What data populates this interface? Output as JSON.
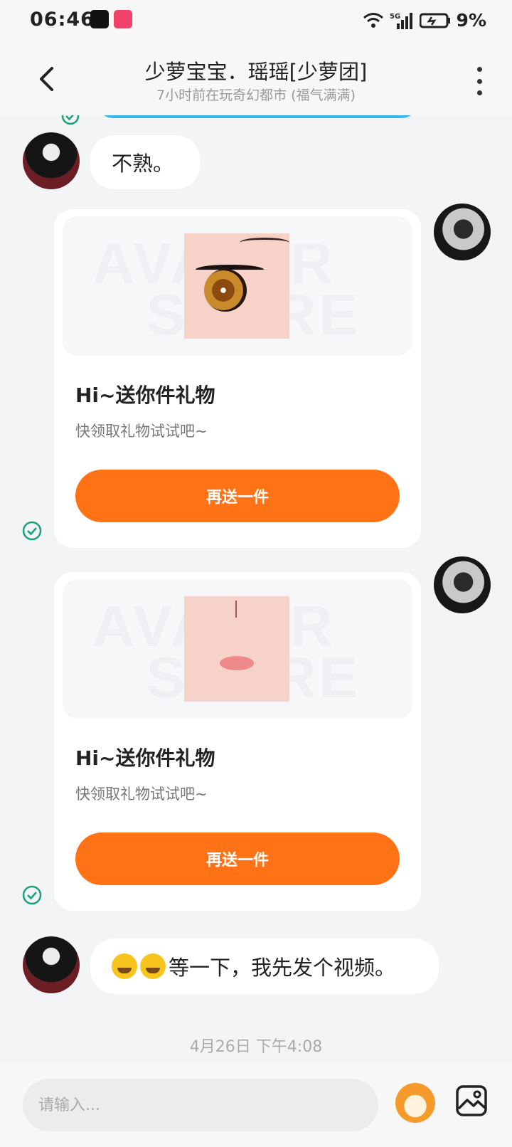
{
  "status_bar": {
    "time": "06:46",
    "network": "5G",
    "battery": "9%"
  },
  "header": {
    "title": "少萝宝宝．瑶瑶[少萝团]",
    "subtitle": "7小时前在玩奇幻都市 (福气满满)"
  },
  "messages": {
    "m1": {
      "text": "不熟。"
    },
    "gift1": {
      "title": "Hi~送你件礼物",
      "desc": "快领取礼物试试吧~",
      "button": "再送一件",
      "watermark_top": "AVATAR",
      "watermark_bottom": "STORE"
    },
    "gift2": {
      "title": "Hi~送你件礼物",
      "desc": "快领取礼物试试吧~",
      "button": "再送一件",
      "watermark_top": "AVATAR",
      "watermark_bottom": "STORE"
    },
    "m2": {
      "text": "等一下，我先发个视频。"
    }
  },
  "timestamp": "4月26日 下午4:08",
  "input": {
    "placeholder": "请输入..."
  },
  "colors": {
    "accent": "#ff7316",
    "sent_bubble": "#35b7f3",
    "check": "#1aa37a"
  }
}
